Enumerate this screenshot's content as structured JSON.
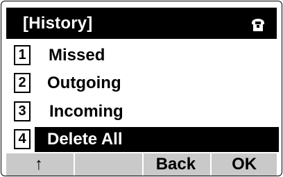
{
  "header": {
    "title": "[History]",
    "status_icon": "handset-icon"
  },
  "menu": {
    "items": [
      {
        "number": "1",
        "label": "Missed",
        "selected": false
      },
      {
        "number": "2",
        "label": "Outgoing",
        "selected": false
      },
      {
        "number": "3",
        "label": "Incoming",
        "selected": false
      },
      {
        "number": "4",
        "label": "Delete All",
        "selected": true
      }
    ]
  },
  "softkeys": {
    "key1": "↑",
    "key2": "",
    "key3": "Back",
    "key4": "OK"
  },
  "colors": {
    "title_bg": "#000000",
    "softkey_bg": "#c9c9c9",
    "selected_bg": "#000000"
  }
}
